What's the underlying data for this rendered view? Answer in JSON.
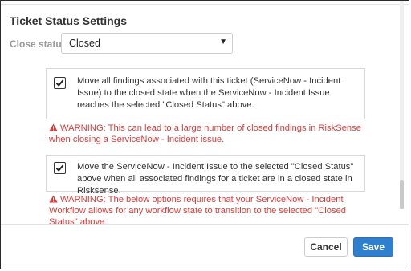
{
  "dialog": {
    "title": "Ticket Status Settings",
    "close_status": {
      "label": "Close status:",
      "selected": "Closed"
    },
    "options": [
      {
        "checked": true,
        "text": "Move all findings associated with this ticket (ServiceNow - Incident Issue) to the closed state when the ServiceNow - Incident Issue reaches the selected \"Closed Status\" above.",
        "warning": "WARNING: This can lead to a large number of closed findings in RiskSense when closing a ServiceNow - Incident issue."
      },
      {
        "checked": true,
        "text": "Move the ServiceNow - Incident Issue to the selected \"Closed Status\" above when all associated findings for a ticket are in a closed state in Risksense.",
        "warning": "WARNING: The below options requires that your ServiceNow - Incident Workflow allows for any workflow state to transition to the selected \"Closed Status\" above."
      }
    ],
    "buttons": {
      "cancel": "Cancel",
      "save": "Save"
    }
  },
  "colors": {
    "warning": "#e03a3a",
    "primary": "#2f7fcf"
  },
  "icons": {
    "caret": "caret-down-icon",
    "check": "checkmark-icon",
    "warning": "warning-triangle-icon"
  }
}
